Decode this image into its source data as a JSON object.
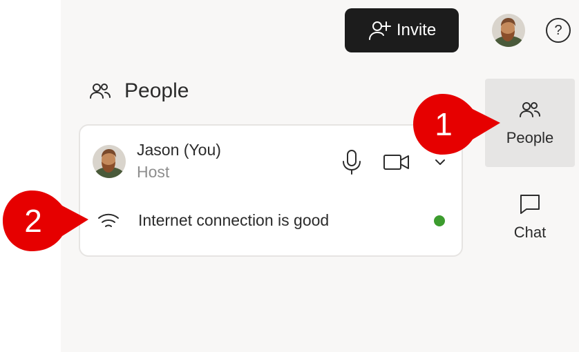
{
  "header": {
    "invite_label": "Invite",
    "help_label": "?"
  },
  "panel": {
    "title": "People"
  },
  "participant": {
    "name": "Jason (You)",
    "role": "Host",
    "connection_text": "Internet connection is good",
    "connection_status_color": "#3c9c2e"
  },
  "rail": {
    "people_label": "People",
    "chat_label": "Chat"
  },
  "callouts": {
    "first": "1",
    "second": "2",
    "color": "#e60000"
  }
}
